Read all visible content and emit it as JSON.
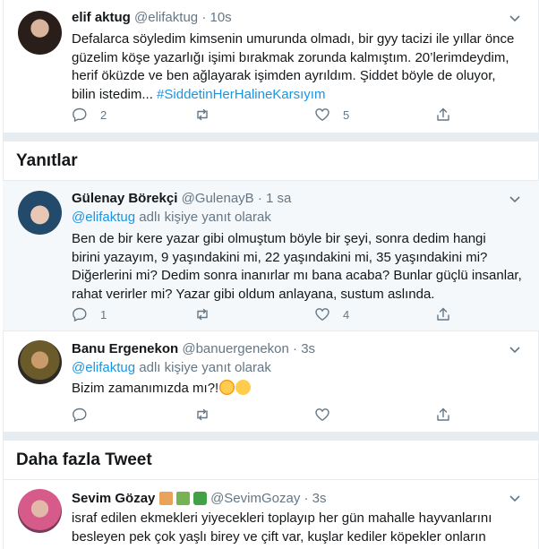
{
  "tweets": [
    {
      "name": "elif aktug",
      "handle": "@elifaktug",
      "time": "· 10s",
      "body": "Defalarca söyledim kimsenin umurunda olmadı, bir gyy tacizi ile yıllar önce\ngüzelim köşe yazarlığı işimi bırakmak zorunda kalmıştım. 20’lerimdeydim,\nherif öküzde ve ben ağlayarak işimden ayrıldım. Şiddet böyle de oluyor,\nbilin istedim... ",
      "hashtag": "#SiddetinHerHalineKarsıyım",
      "reply_count": "2",
      "retweet_count": "",
      "like_count": "5"
    }
  ],
  "sections": {
    "replies_title": "Yanıtlar",
    "more_title": "Daha fazla Tweet"
  },
  "replies": [
    {
      "name": "Gülenay Börekçi",
      "handle": "@GulenayB",
      "time": "· 1 sa",
      "reply_to_handle": "@elifaktug",
      "reply_to_suffix": " adlı kişiye yanıt olarak",
      "body": "Ben de bir kere yazar gibi olmuştum böyle bir şeyi, sonra dedim hangi\nbirini yazayım, 9 yaşındakini mi, 22 yaşındakini mi, 35 yaşındakini mi?\nDiğerlerini mi? Dedim sonra inanırlar mı bana acaba? Bunlar güçlü insanlar,\nrahat verirler mi? Yazar gibi oldum anlayana, sustum aslında.",
      "reply_count": "1",
      "like_count": "4"
    },
    {
      "name": "Banu Ergenekon",
      "handle": "@banuergenekon",
      "time": "· 3s",
      "reply_to_handle": "@elifaktug",
      "reply_to_suffix": " adlı kişiye yanıt olarak",
      "body": "Bizim zamanımızda mı?!",
      "reply_count": "",
      "like_count": ""
    }
  ],
  "more": [
    {
      "name": "Sevim Gözay",
      "handle": "@SevimGozay",
      "time": "· 3s",
      "body": "israf edilen ekmekleri yiyecekleri toplayıp her gün mahalle hayvanlarını\nbesleyen pek çok yaşlı birey ve çift var, kuşlar kediler köpekler onların\nsabırsızlıkla..."
    }
  ],
  "icons": {
    "reply": "reply-icon",
    "retweet": "retweet-icon",
    "like": "like-icon",
    "share": "share-icon",
    "caret": "chevron-down-icon"
  },
  "colors": {
    "accent": "#1b95e0",
    "muted": "#657786",
    "divider": "#e6ecf0",
    "highlight_bg": "#f5f8fa"
  }
}
